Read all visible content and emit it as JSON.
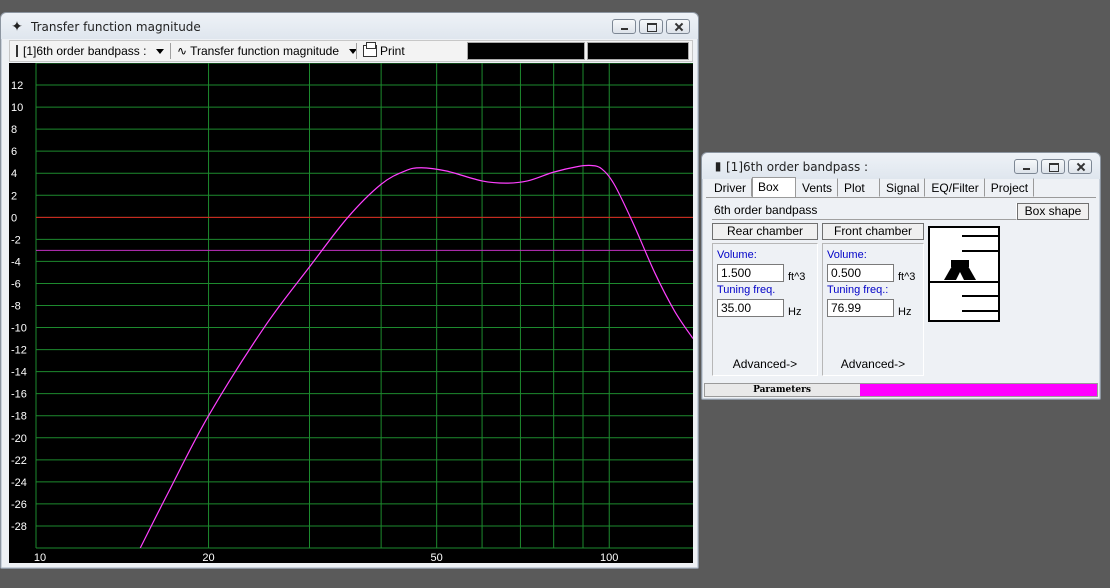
{
  "main_window": {
    "title": "Transfer function magnitude",
    "toolbar": {
      "project_select": "[1]6th order bandpass :",
      "plot_select": "Transfer function magnitude",
      "print_label": "Print"
    }
  },
  "chart_data": {
    "type": "line",
    "x_scale": "log",
    "xlim": [
      10,
      140
    ],
    "ylim": [
      -30,
      14
    ],
    "x_tick_labels": [
      "10",
      "20",
      "50",
      "100"
    ],
    "x_ticks": [
      10,
      20,
      50,
      100
    ],
    "y_tick_labels": [
      "12",
      "10",
      "8",
      "6",
      "4",
      "2",
      "0",
      "-2",
      "-4",
      "-6",
      "-8",
      "-10",
      "-12",
      "-14",
      "-16",
      "-18",
      "-20",
      "-22",
      "-24",
      "-26",
      "-28"
    ],
    "y_ticks": [
      12,
      10,
      8,
      6,
      4,
      2,
      0,
      -2,
      -4,
      -6,
      -8,
      -10,
      -12,
      -14,
      -16,
      -18,
      -20,
      -22,
      -24,
      -26,
      -28
    ],
    "grid": true,
    "background": "#000000",
    "grid_color": "#1d8a2e",
    "reference_lines": [
      {
        "y": 0,
        "color": "#e02020"
      },
      {
        "y": -3,
        "color": "#c030c0"
      }
    ],
    "series": [
      {
        "color": "#ff40ff",
        "x": [
          15.2,
          17,
          20,
          25,
          30,
          35,
          40,
          44,
          47,
          52,
          60,
          66,
          72,
          80,
          88,
          93,
          97,
          102,
          110,
          120,
          130,
          140
        ],
        "y": [
          -30,
          -25,
          -18,
          -10,
          -4.5,
          0,
          3,
          4.2,
          4.5,
          4.2,
          3.3,
          3.1,
          3.3,
          4.1,
          4.6,
          4.7,
          4.4,
          3,
          -0.5,
          -5,
          -8.5,
          -11
        ]
      }
    ]
  },
  "side_window": {
    "title": "[1]6th order bandpass :",
    "tabs": [
      "Driver",
      "Box",
      "Vents",
      "Plot",
      "Signal",
      "EQ/Filter",
      "Project"
    ],
    "active_tab": "Box",
    "box_type": "6th order bandpass",
    "box_shape_button": "Box shape",
    "rear": {
      "header": "Rear chamber",
      "volume_label": "Volume:",
      "volume_value": "1.500",
      "volume_unit": "ft^3",
      "tuning_label": "Tuning freq.",
      "tuning_value": "35.00",
      "tuning_unit": "Hz",
      "advanced": "Advanced->"
    },
    "front": {
      "header": "Front chamber",
      "volume_label": "Volume:",
      "volume_value": "0.500",
      "volume_unit": "ft^3",
      "tuning_label": "Tuning freq.:",
      "tuning_value": "76.99",
      "tuning_unit": "Hz",
      "advanced": "Advanced->"
    },
    "status": {
      "label": "Parameters",
      "progress": 1.0,
      "progress_color": "#ff00ff"
    }
  }
}
